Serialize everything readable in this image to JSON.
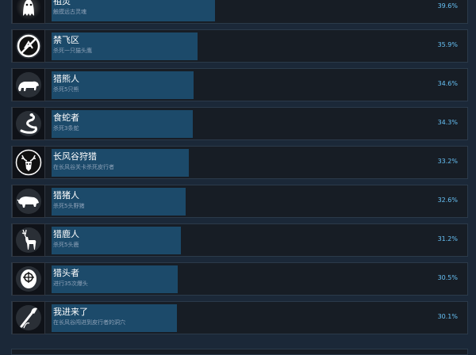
{
  "achievements": [
    {
      "title": "祖灵",
      "desc": "触摸远古灵魂",
      "percent": "39.6%",
      "fill": 0.396,
      "icon": "ghost-icon"
    },
    {
      "title": "禁飞区",
      "desc": "杀死一只猫头鹰",
      "percent": "35.9%",
      "fill": 0.359,
      "icon": "no-fly-zone-icon"
    },
    {
      "title": "猎熊人",
      "desc": "杀死5只熊",
      "percent": "34.6%",
      "fill": 0.346,
      "icon": "bear-icon"
    },
    {
      "title": "食蛇者",
      "desc": "杀死3条蛇",
      "percent": "34.3%",
      "fill": 0.343,
      "icon": "snake-icon"
    },
    {
      "title": "长风谷狩猎",
      "desc": "在长风谷关卡杀死皮行者",
      "percent": "33.2%",
      "fill": 0.332,
      "icon": "antler-skull-icon"
    },
    {
      "title": "猎猪人",
      "desc": "杀死5头野猪",
      "percent": "32.6%",
      "fill": 0.326,
      "icon": "boar-icon"
    },
    {
      "title": "猎鹿人",
      "desc": "杀死5头鹿",
      "percent": "31.2%",
      "fill": 0.312,
      "icon": "deer-icon"
    },
    {
      "title": "猎头者",
      "desc": "进行35次爆头",
      "percent": "30.5%",
      "fill": 0.305,
      "icon": "crosshair-head-icon"
    },
    {
      "title": "我进来了",
      "desc": "在长风谷闯进到皮行者的洞穴",
      "percent": "30.1%",
      "fill": 0.301,
      "icon": "torch-icon"
    }
  ]
}
